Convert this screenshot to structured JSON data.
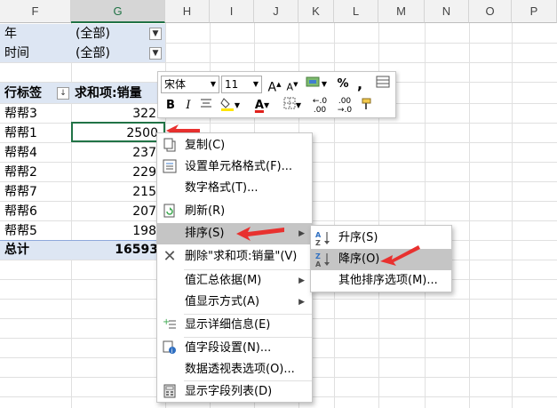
{
  "columns": [
    "F",
    "G",
    "H",
    "I",
    "J",
    "K",
    "L",
    "M",
    "N",
    "O",
    "P"
  ],
  "filters": [
    {
      "label": "年",
      "value": "(全部)"
    },
    {
      "label": "时间",
      "value": "(全部)"
    }
  ],
  "pivot": {
    "row_header": "行标签",
    "value_header": "求和项:销量",
    "rows": [
      {
        "label": "帮帮3",
        "value": "322"
      },
      {
        "label": "帮帮1",
        "value": "2500"
      },
      {
        "label": "帮帮4",
        "value": "237"
      },
      {
        "label": "帮帮2",
        "value": "229"
      },
      {
        "label": "帮帮7",
        "value": "215"
      },
      {
        "label": "帮帮6",
        "value": "207"
      },
      {
        "label": "帮帮5",
        "value": "198"
      }
    ],
    "total_label": "总计",
    "total_value": "16593"
  },
  "mini_toolbar": {
    "font_name": "宋体",
    "font_size": "11",
    "bold": "B",
    "italic": "I",
    "percent": "%",
    "comma": ","
  },
  "context_menu": {
    "items": [
      {
        "label": "复制(C)",
        "icon": "copy-icon"
      },
      {
        "label": "设置单元格格式(F)...",
        "icon": "format-cells-icon"
      },
      {
        "label": "数字格式(T)...",
        "icon": ""
      },
      {
        "label": "刷新(R)",
        "icon": "refresh-icon"
      },
      {
        "label": "排序(S)",
        "icon": "",
        "submenu": true
      },
      {
        "label": "删除\"求和项:销量\"(V)",
        "icon": "delete-x-icon"
      },
      {
        "label": "值汇总依据(M)",
        "icon": "",
        "submenu": true
      },
      {
        "label": "值显示方式(A)",
        "icon": "",
        "submenu": true
      },
      {
        "label": "显示详细信息(E)",
        "icon": "show-details-icon"
      },
      {
        "label": "值字段设置(N)...",
        "icon": "field-settings-icon"
      },
      {
        "label": "数据透视表选项(O)...",
        "icon": ""
      },
      {
        "label": "显示字段列表(D)",
        "icon": "field-list-icon"
      }
    ]
  },
  "sort_submenu": {
    "items": [
      {
        "label": "升序(S)",
        "icon": "sort-ascending-icon"
      },
      {
        "label": "降序(O)",
        "icon": "sort-descending-icon"
      },
      {
        "label": "其他排序选项(M)...",
        "icon": ""
      }
    ]
  },
  "colors": {
    "pivot_band": "#dde6f3",
    "selection_green": "#217346",
    "highlight": "#c5c5c5",
    "arrow_red": "#e8312f",
    "font_color_red": "#e0201b",
    "highlight_yellow": "#ffe600"
  }
}
